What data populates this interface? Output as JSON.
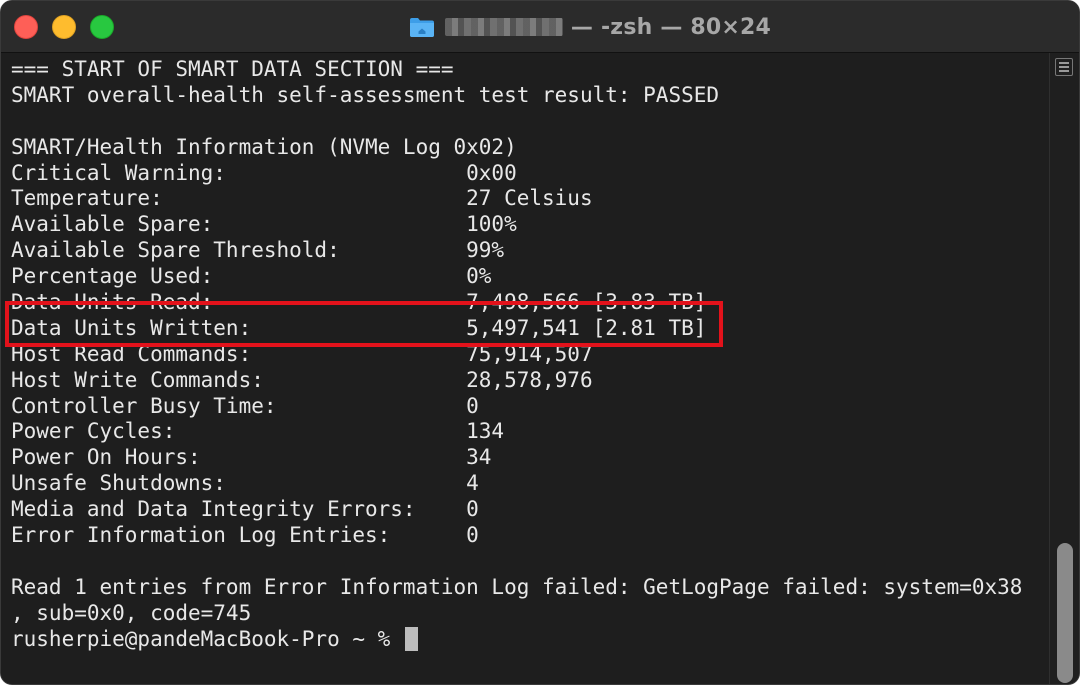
{
  "window": {
    "title": "— -zsh — 80×24",
    "icon": "folder-icon"
  },
  "terminal": {
    "lines": [
      "=== START OF SMART DATA SECTION ===",
      "SMART overall-health self-assessment test result: PASSED",
      "",
      "SMART/Health Information (NVMe Log 0x02)",
      "Critical Warning:                   0x00",
      "Temperature:                        27 Celsius",
      "Available Spare:                    100%",
      "Available Spare Threshold:          99%",
      "Percentage Used:                    0%",
      "Data Units Read:                    7,498,566 [3.83 TB]",
      "Data Units Written:                 5,497,541 [2.81 TB]",
      "Host Read Commands:                 75,914,507",
      "Host Write Commands:                28,578,976",
      "Controller Busy Time:               0",
      "Power Cycles:                       134",
      "Power On Hours:                     34",
      "Unsafe Shutdowns:                   4",
      "Media and Data Integrity Errors:    0",
      "Error Information Log Entries:      0",
      "",
      "Read 1 entries from Error Information Log failed: GetLogPage failed: system=0x38",
      ", sub=0x0, code=745",
      ""
    ],
    "prompt": "rusherpie@pandeMacBook-Pro ~ % "
  },
  "colors": {
    "highlight": "#e3121b",
    "background": "#1e1e1e",
    "text": "#e8e8e8"
  }
}
